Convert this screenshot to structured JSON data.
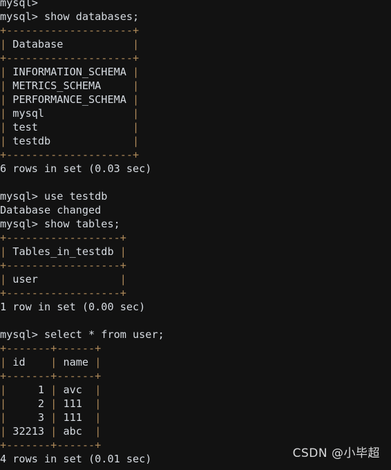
{
  "terminal": {
    "background_color": "#121212",
    "text_color": "#d6dbe1",
    "border_color": "#b08b5a",
    "prompt": "mysql>",
    "lines": [
      {
        "kind": "prompt",
        "text": "mysql>"
      },
      {
        "kind": "prompt",
        "text": "mysql> show databases;"
      },
      {
        "kind": "border",
        "text": "+--------------------+"
      },
      {
        "kind": "row",
        "text": "| Database           |"
      },
      {
        "kind": "border",
        "text": "+--------------------+"
      },
      {
        "kind": "row",
        "text": "| INFORMATION_SCHEMA |"
      },
      {
        "kind": "row",
        "text": "| METRICS_SCHEMA     |"
      },
      {
        "kind": "row",
        "text": "| PERFORMANCE_SCHEMA |"
      },
      {
        "kind": "row",
        "text": "| mysql              |"
      },
      {
        "kind": "row",
        "text": "| test               |"
      },
      {
        "kind": "row",
        "text": "| testdb             |"
      },
      {
        "kind": "border",
        "text": "+--------------------+"
      },
      {
        "kind": "text",
        "text": "6 rows in set (0.03 sec)"
      },
      {
        "kind": "blank",
        "text": ""
      },
      {
        "kind": "prompt",
        "text": "mysql> use testdb"
      },
      {
        "kind": "text",
        "text": "Database changed"
      },
      {
        "kind": "prompt",
        "text": "mysql> show tables;"
      },
      {
        "kind": "border",
        "text": "+------------------+"
      },
      {
        "kind": "row",
        "text": "| Tables_in_testdb |"
      },
      {
        "kind": "border",
        "text": "+------------------+"
      },
      {
        "kind": "row",
        "text": "| user             |"
      },
      {
        "kind": "border",
        "text": "+------------------+"
      },
      {
        "kind": "text",
        "text": "1 row in set (0.00 sec)"
      },
      {
        "kind": "blank",
        "text": ""
      },
      {
        "kind": "prompt",
        "text": "mysql> select * from user;"
      },
      {
        "kind": "border",
        "text": "+-------+------+"
      },
      {
        "kind": "row",
        "text": "| id    | name |"
      },
      {
        "kind": "border",
        "text": "+-------+------+"
      },
      {
        "kind": "row",
        "text": "|     1 | avc  |"
      },
      {
        "kind": "row",
        "text": "|     2 | 111  |"
      },
      {
        "kind": "row",
        "text": "|     3 | 111  |"
      },
      {
        "kind": "row",
        "text": "| 32213 | abc  |"
      },
      {
        "kind": "border",
        "text": "+-------+------+"
      },
      {
        "kind": "text",
        "text": "4 rows in set (0.01 sec)"
      }
    ],
    "commands": [
      "show databases;",
      "use testdb",
      "show tables;",
      "select * from user;"
    ],
    "results": {
      "databases": {
        "header": "Database",
        "rows": [
          "INFORMATION_SCHEMA",
          "METRICS_SCHEMA",
          "PERFORMANCE_SCHEMA",
          "mysql",
          "test",
          "testdb"
        ],
        "status": "6 rows in set (0.03 sec)"
      },
      "use_db": {
        "message": "Database changed",
        "database": "testdb"
      },
      "tables": {
        "header": "Tables_in_testdb",
        "rows": [
          "user"
        ],
        "status": "1 row in set (0.00 sec)"
      },
      "user_table": {
        "headers": [
          "id",
          "name"
        ],
        "rows": [
          [
            "1",
            "avc"
          ],
          [
            "2",
            "111"
          ],
          [
            "3",
            "111"
          ],
          [
            "32213",
            "abc"
          ]
        ],
        "status": "4 rows in set (0.01 sec)"
      }
    }
  },
  "watermark": {
    "text": "CSDN @小毕超"
  }
}
